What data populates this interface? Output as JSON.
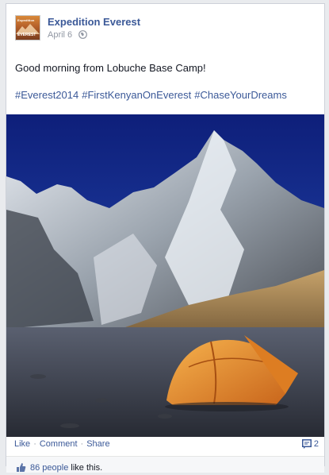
{
  "post": {
    "page_name": "Expedition Everest",
    "date": "April 6",
    "privacy_icon": "globe-icon",
    "avatar": {
      "logo_text": "Expedition",
      "logo_sub": "EVEREST"
    },
    "message": "Good morning from Lobuche Base Camp!",
    "hashtags": [
      "#Everest2014",
      "#FirstKenyanOnEverest",
      "#ChaseYourDreams"
    ],
    "photo_description_icon": "mountain-photo"
  },
  "actions": {
    "like": "Like",
    "comment": "Comment",
    "share": "Share",
    "separator": "·",
    "comment_count": "2"
  },
  "likes": {
    "people": "86 people",
    "suffix": " like this."
  },
  "colors": {
    "link": "#3b5998",
    "meta": "#9197a3",
    "sky": "#1f3fa3",
    "tent": "#e8892a"
  }
}
